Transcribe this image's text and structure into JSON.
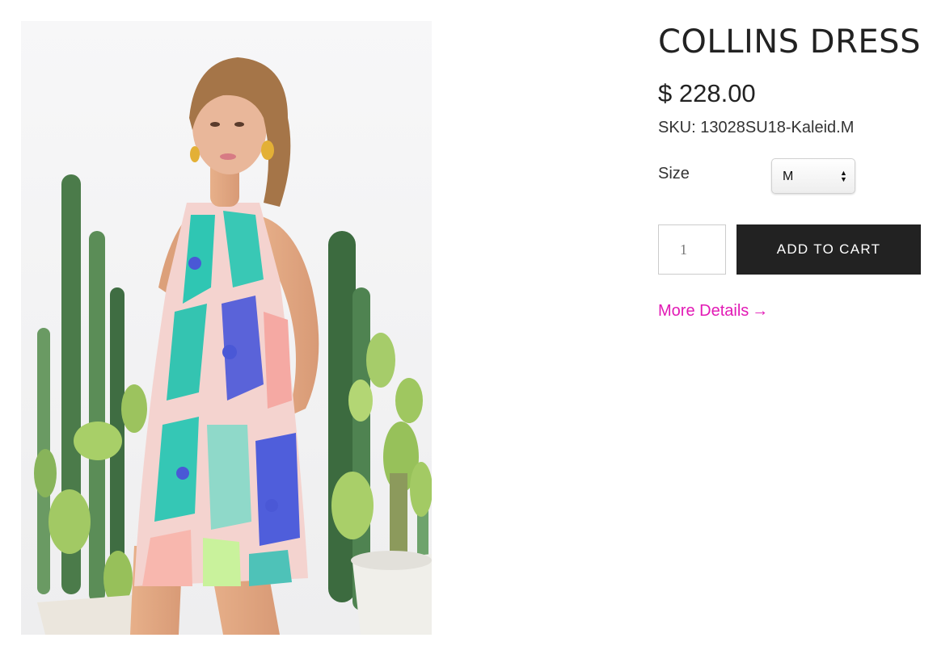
{
  "product": {
    "title": "COLLINS DRESS",
    "price": "$ 228.00",
    "sku": "SKU: 13028SU18-Kaleid.M",
    "size": {
      "label": "Size",
      "selected": "M"
    },
    "quantity": "1",
    "add_to_cart_label": "ADD TO CART",
    "more_details_label": "More Details",
    "more_details_arrow": "→"
  },
  "colors": {
    "accent_link": "#e21ab5",
    "button_bg": "#222222",
    "button_text": "#ffffff"
  },
  "icons": {
    "select_arrows": "select-arrows-icon",
    "arrow_right": "arrow-right-icon"
  }
}
